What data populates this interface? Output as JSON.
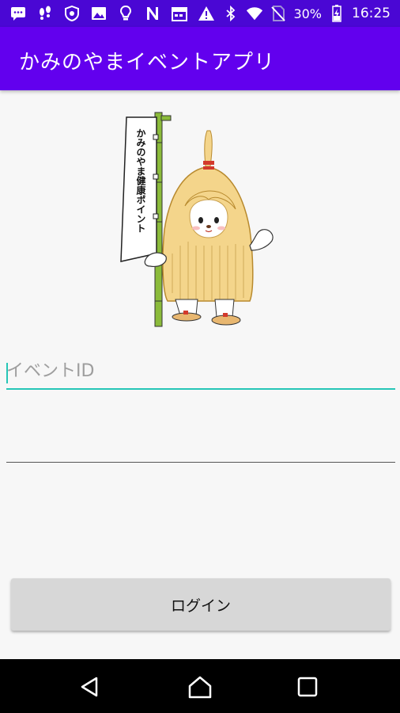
{
  "status_bar": {
    "battery_percent": "30%",
    "time": "16:25",
    "left_icons": [
      "chat-icon",
      "steps-icon",
      "shield-icon",
      "image-icon",
      "bulb-icon",
      "n-icon",
      "calendar-icon",
      "warning-icon"
    ],
    "right_icons": [
      "bluetooth-icon",
      "wifi-icon",
      "no-sim-icon",
      "battery-icon"
    ],
    "bg_color": "#4a07d4"
  },
  "app_bar": {
    "title": "かみのやまイベントアプリ",
    "bg_color": "#6200ee"
  },
  "mascot": {
    "banner_text": "かみのやま健康ポイント"
  },
  "form": {
    "event_id_placeholder": "イベントID",
    "event_id_value": "",
    "second_field_value": "",
    "accent_color": "#26c6b7"
  },
  "login_button": {
    "label": "ログイン"
  },
  "nav_bar": {
    "buttons": [
      "back-icon",
      "home-icon",
      "recents-icon"
    ]
  }
}
